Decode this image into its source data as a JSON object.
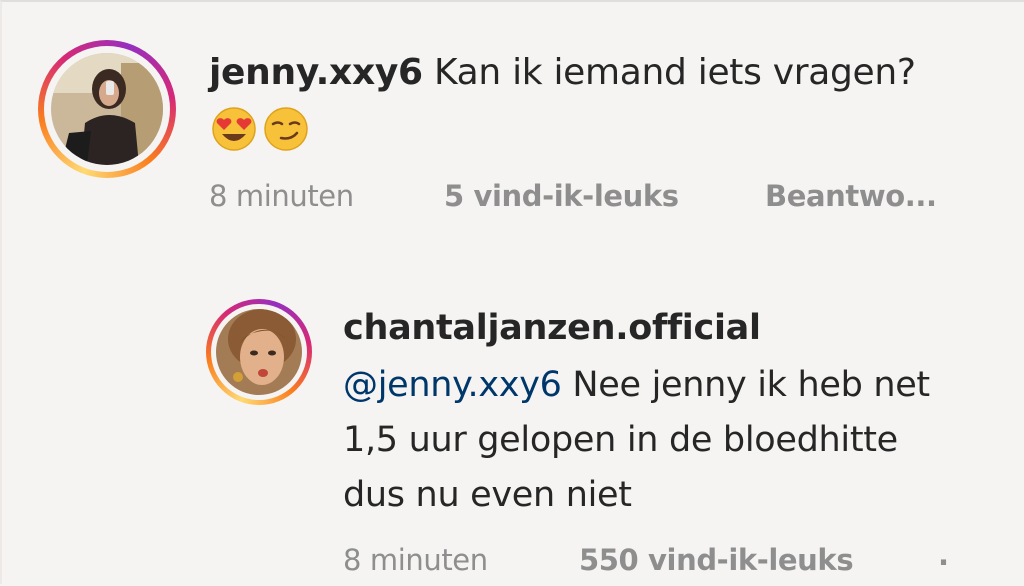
{
  "comments": [
    {
      "username": "jenny.xxy6",
      "text": "Kan ik iemand iets vragen?",
      "emojis": [
        "heart-eyes-emoji",
        "smirk-emoji"
      ],
      "time": "8 minuten",
      "likes": "5 vind-ik-leuks",
      "reply": "Beantwo..."
    },
    {
      "username": "chantaljanzen.official",
      "mention": "@jenny.xxy6",
      "text_line1": "Nee jenny ik heb net",
      "text_line2": "1,5 uur gelopen in de bloedhitte",
      "text_line3": "dus nu even niet",
      "time": "8 minuten",
      "likes": "550 vind-ik-leuks",
      "more": "."
    }
  ],
  "colors": {
    "text": "#262626",
    "meta": "#8e8e8e",
    "mention": "#00376b",
    "background": "#f5f4f2"
  }
}
